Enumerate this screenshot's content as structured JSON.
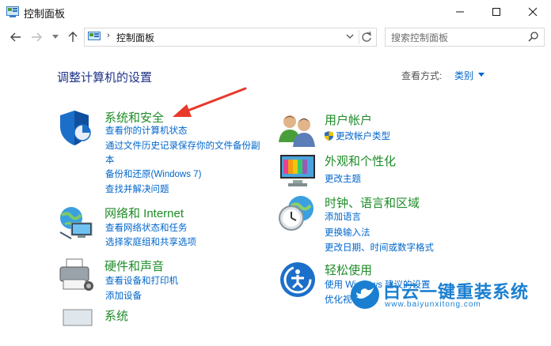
{
  "window": {
    "title": "控制面板"
  },
  "navigation": {
    "breadcrumb_separator": "›",
    "breadcrumb": "控制面板",
    "search_placeholder": "搜索控制面板"
  },
  "main": {
    "heading": "调整计算机的设置",
    "view_by_label": "查看方式:",
    "view_by_value": "类别"
  },
  "categories": [
    {
      "title": "系统和安全",
      "links": [
        "查看你的计算机状态",
        "通过文件历史记录保存你的文件备份副",
        "本",
        "备份和还原(Windows 7)",
        "查找并解决问题"
      ]
    },
    {
      "title": "网络和 Internet",
      "links": [
        "查看网络状态和任务",
        "选择家庭组和共享选项"
      ]
    },
    {
      "title": "硬件和声音",
      "links": [
        "查看设备和打印机",
        "添加设备"
      ]
    },
    {
      "title": "系统",
      "links": []
    },
    {
      "title": "用户帐户",
      "links": [
        "更改帐户类型"
      ]
    },
    {
      "title": "外观和个性化",
      "links": [
        "更改主题"
      ]
    },
    {
      "title": "时钟、语言和区域",
      "links": [
        "添加语言",
        "更换输入法",
        "更改日期、时间或数字格式"
      ]
    },
    {
      "title": "轻松使用",
      "links": [
        "使用 Windows 建议的设置",
        "优化视"
      ]
    }
  ],
  "watermark": {
    "text": "白云一键重装系统",
    "url": "www.baiyunxitong.com"
  },
  "colors": {
    "category_title": "#1e8c28",
    "link": "#0066cc",
    "heading": "#1e3287",
    "annotation_arrow": "#e8392b"
  }
}
